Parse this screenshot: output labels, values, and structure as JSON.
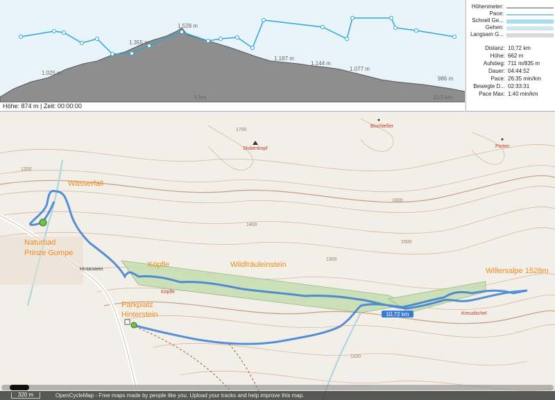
{
  "profile": {
    "status": "Höhe: 874 m | Zeit: 00:00:00",
    "labels": [
      "1.528 m",
      "1.355 m",
      "1.187 m",
      "1.144 m",
      "1.077 m",
      "986 m",
      "1.025 m",
      "5 km",
      "10,5 km"
    ]
  },
  "legend": [
    {
      "label": "Höhenmeter:",
      "color": "#555555"
    },
    {
      "label": "Pace:",
      "color": "#2aa6d8"
    },
    {
      "label": "Schnell Ge...",
      "color": "#a9dcef"
    },
    {
      "label": "Gehen:",
      "color": "#cfe5ef"
    },
    {
      "label": "Langsam G...",
      "color": "#d9d9d9"
    }
  ],
  "stats": [
    {
      "key": "Distanz:",
      "value": "10,72 km"
    },
    {
      "key": "Höhe:",
      "value": "662 m"
    },
    {
      "key": "Aufstieg:",
      "value": "711 m/835 m"
    },
    {
      "key": "Dauer:",
      "value": "04:44:52"
    },
    {
      "key": "Pace:",
      "value": "26:35 min/km"
    },
    {
      "key": "Bewegte D...",
      "value": "02:33:31"
    },
    {
      "key": "Pace Max:",
      "value": "1:40 min/km"
    }
  ],
  "map": {
    "places": {
      "wasserfall": "Wasserfall",
      "naturbad": "Naturbad",
      "prinze_gumpe": "Prinze Gumpe",
      "koepfle": "Köpfle",
      "wildfraeulein": "Wildfräuleinstein",
      "parkplatz": "Parkplatz",
      "hinterstein_label": "Hinterstein",
      "willersalpe": "Willersalpe 1528m",
      "hinterstein_town": "Hinterstein",
      "stubenkopf": "Stubenkopf",
      "bischlesser": "Bischleßer",
      "porten": "Porten",
      "kreuzbichel": "Kreuzbichel",
      "koepfle_small": "Köpfle"
    },
    "distance_badge": "10,72 km",
    "contours": [
      "1400",
      "1500",
      "1300",
      "1600",
      "1700",
      "1100",
      "1200"
    ]
  },
  "attribution": {
    "scale": "320 m",
    "text": "OpenCycleMap - Free maps made by people like you. Upload your tracks and help improve this map."
  }
}
